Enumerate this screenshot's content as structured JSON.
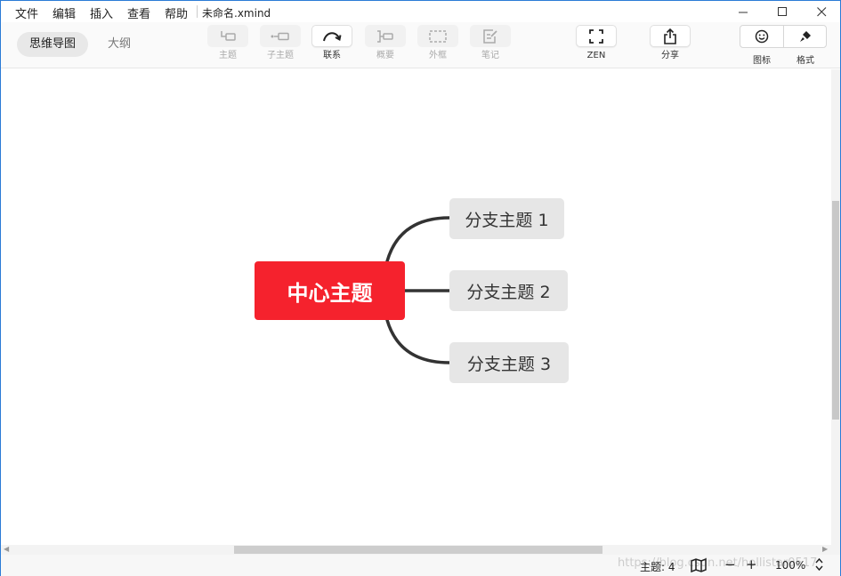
{
  "menu": {
    "file": "文件",
    "edit": "编辑",
    "insert": "插入",
    "view": "查看",
    "help": "帮助"
  },
  "document": {
    "title": "未命名.xmind"
  },
  "view_tabs": {
    "mindmap": "思维导图",
    "outline": "大纲"
  },
  "toolbar": {
    "topic": "主题",
    "subtopic": "子主题",
    "relationship": "联系",
    "summary": "概要",
    "boundary": "外框",
    "note": "笔记",
    "zen": "ZEN",
    "share": "分享",
    "icons": "图标",
    "format": "格式"
  },
  "mindmap": {
    "central_topic": "中心主题",
    "branches": [
      "分支主题 1",
      "分支主题 2",
      "分支主题 3"
    ],
    "central_color": "#f5222d",
    "branch_color": "#e6e6e6",
    "connector_color": "#333333"
  },
  "status": {
    "topic_count": "主题: 4",
    "zoom": "100%",
    "zoom_out": "−",
    "zoom_in": "+",
    "watermark": "https://blog.csdn.net/hollistar0517"
  }
}
